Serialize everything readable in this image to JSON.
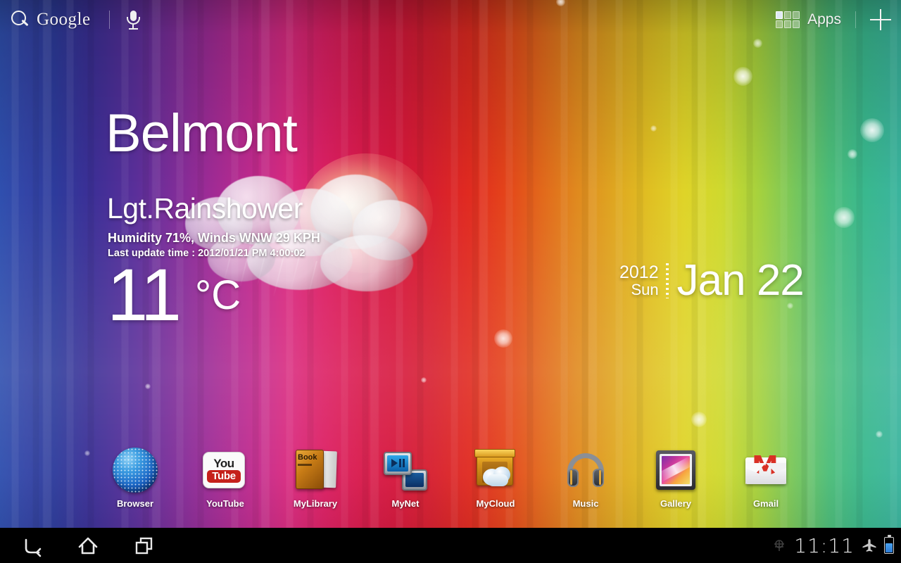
{
  "topbar": {
    "search_label": "Google",
    "search_icon": "search-icon",
    "mic_icon": "microphone-icon",
    "apps_label": "Apps",
    "apps_icon": "apps-grid-icon",
    "add_icon": "plus-icon"
  },
  "weather": {
    "city": "Belmont",
    "condition": "Lgt.Rainshower",
    "details": "Humidity 71%, Winds WNW 29 KPH",
    "last_update": "Last update time : 2012/01/21 PM 4:00:02",
    "temperature": "11",
    "unit": "°C",
    "icon": "rain-cloud-icon"
  },
  "date_widget": {
    "year": "2012",
    "weekday": "Sun",
    "date": "Jan 22"
  },
  "dock": {
    "items": [
      {
        "label": "Browser",
        "icon": "browser-globe-icon"
      },
      {
        "label": "YouTube",
        "icon": "youtube-icon",
        "you": "You",
        "tube": "Tube"
      },
      {
        "label": "MyLibrary",
        "icon": "book-icon",
        "book_title": "Book"
      },
      {
        "label": "MyNet",
        "icon": "mynet-screens-icon"
      },
      {
        "label": "MyCloud",
        "icon": "mycloud-box-icon"
      },
      {
        "label": "Music",
        "icon": "headphones-icon"
      },
      {
        "label": "Gallery",
        "icon": "gallery-photo-icon"
      },
      {
        "label": "Gmail",
        "icon": "gmail-envelope-icon",
        "glyph": "M"
      }
    ]
  },
  "navbar": {
    "back_icon": "back-arrow-icon",
    "home_icon": "home-icon",
    "recent_icon": "recent-apps-icon",
    "usb_icon": "usb-debug-icon",
    "clock": "11:11",
    "airplane_icon": "airplane-mode-icon",
    "battery_icon": "battery-icon"
  },
  "colors": {
    "accent_red": "#c5211b",
    "gmail_red": "#d93025",
    "battery_blue": "#2d7ad4"
  }
}
